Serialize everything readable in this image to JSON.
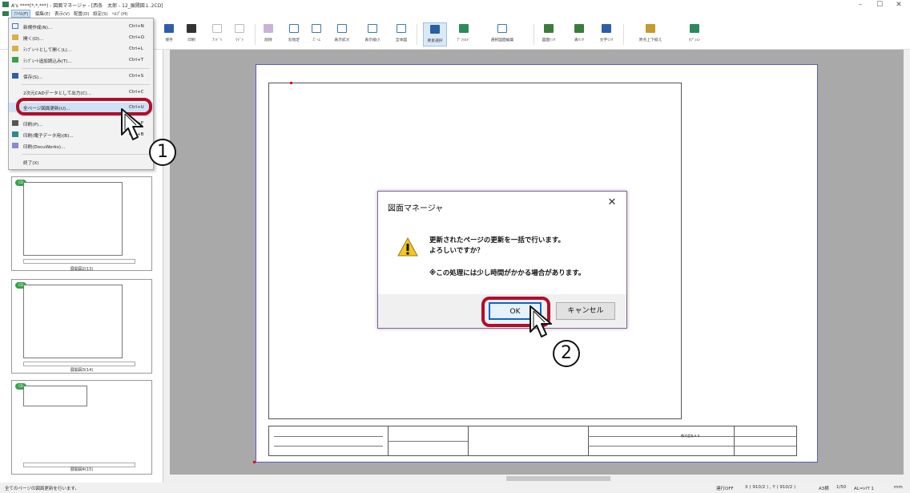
{
  "window": {
    "title": "A's ****(*,*,***) - 図面マネージャ - [西条　太郎 - 12_展開図１.2CD]",
    "minimize": "–",
    "maximize": "☐",
    "close": "✕"
  },
  "menubar": {
    "items": [
      {
        "label": "ﾌｧｲﾙ(F)"
      },
      {
        "label": "編集(E)"
      },
      {
        "label": "表示(V)"
      },
      {
        "label": "配置(D)"
      },
      {
        "label": "設定(S)"
      },
      {
        "label": "ﾍﾙﾌﾟ(H)"
      }
    ]
  },
  "toolbar": {
    "buttons": [
      {
        "label": "保存",
        "icon": "save-icon"
      },
      {
        "label": "印刷",
        "icon": "print-icon"
      },
      {
        "label": "ｱﾝﾄﾞｩ",
        "icon": "undo-icon"
      },
      {
        "label": "ﾘﾄﾞｩ",
        "icon": "redo-icon"
      },
      {
        "label": "削除",
        "icon": "delete-icon"
      },
      {
        "label": "窓指定",
        "icon": "window-zoom-icon"
      },
      {
        "label": "ｽﾞｰﾑ",
        "icon": "zoom-icon"
      },
      {
        "label": "表示拡大",
        "icon": "zoom-in-icon"
      },
      {
        "label": "表示縮小",
        "icon": "zoom-out-icon"
      },
      {
        "label": "全体図",
        "icon": "fit-all-icon"
      },
      {
        "label": "要素選択",
        "icon": "select-icon"
      },
      {
        "label": "ﾃﾞﾌｫﾙﾄﾞ",
        "icon": "default-icon"
      },
      {
        "label": "選択図面編集",
        "icon": "edit-drawing-icon"
      },
      {
        "label": "図面ﾘﾝｸ",
        "icon": "drawing-link-icon"
      },
      {
        "label": "表ﾘﾝｸ",
        "icon": "table-link-icon"
      },
      {
        "label": "文字ﾘﾝｸ",
        "icon": "text-link-icon"
      },
      {
        "label": "原点上下揃え",
        "icon": "align-origin-icon"
      },
      {
        "label": "ｵﾌﾟｼｮﾝ",
        "icon": "option-icon"
      }
    ]
  },
  "file_menu": {
    "items": [
      {
        "label": "新規作成(N)...",
        "shortcut": "Ctrl+N"
      },
      {
        "label": "開く(O)...",
        "shortcut": "Ctrl+O"
      },
      {
        "label": "ﾃﾝﾌﾟﾚｰﾄとして開く(L)...",
        "shortcut": "Ctrl+L"
      },
      {
        "label": "ﾃﾝﾌﾟﾚｰﾄ追加読込み(T)...",
        "shortcut": "Ctrl+T"
      },
      {
        "label": "保存(S)...",
        "shortcut": "Ctrl+S"
      },
      {
        "label": "2次元CADデータとして出力(C)...",
        "shortcut": "Ctrl+C"
      },
      {
        "label": "全ページ図面更新(U)...",
        "shortcut": "Ctrl+U"
      },
      {
        "label": "印刷(P)...",
        "shortcut": "Ctrl+P"
      },
      {
        "label": "印刷(電子データ用)(B)...",
        "shortcut": "Ctrl+B"
      },
      {
        "label": "印刷(DocuWorks)...",
        "shortcut": ""
      },
      {
        "label": "終了(X)",
        "shortcut": ""
      }
    ]
  },
  "thumbnails": [
    {
      "caption": "展開図2(13)",
      "badge": "CD"
    },
    {
      "caption": "展開図3(14)",
      "badge": "CD"
    },
    {
      "caption": "展開図4(15)",
      "badge": "CD"
    }
  ],
  "dialog": {
    "title": "図面マネージャ",
    "close": "✕",
    "line1": "更新されたページの更新を一括で行います。",
    "line2": "よろしいですか？",
    "line3": "※この処理には少し時間がかかる場合があります。",
    "ok": "OK",
    "cancel": "キャンセル"
  },
  "callouts": {
    "one": "1",
    "two": "2"
  },
  "statusbar": {
    "message": "全てのページの図面更新を行います。",
    "mode": "連行OFF",
    "coords": "X ( 910/2 ) , Y ( 910/2 )",
    "paper": "A3横",
    "scale": "1/50",
    "layer": "AL=ﾚｲﾔ 1",
    "unit": "mm"
  },
  "titleblock": {
    "company": "株式会社ＡＳ"
  },
  "colors": {
    "highlight_ring": "#b10e2a",
    "ok_border": "#0b66c8",
    "canvas": "#a9a9a9",
    "paper_border": "#5a5ad0"
  }
}
